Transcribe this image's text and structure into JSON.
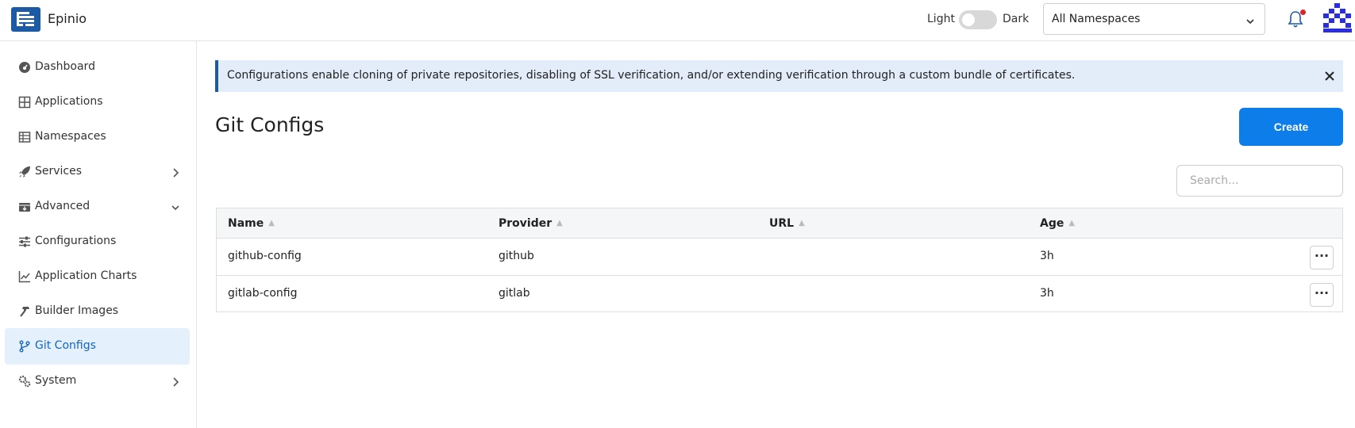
{
  "header": {
    "app_name": "Epinio",
    "theme_light": "Light",
    "theme_dark": "Dark",
    "namespace_selected": "All Namespaces",
    "brand_color": "#1c5aa6",
    "notification_dot_color": "#d9262d"
  },
  "sidebar": {
    "items": [
      {
        "label": "Dashboard",
        "icon": "dashboard-icon"
      },
      {
        "label": "Applications",
        "icon": "grid-icon"
      },
      {
        "label": "Namespaces",
        "icon": "table-icon"
      },
      {
        "label": "Services",
        "icon": "rocket-icon",
        "expand": "chevron-right"
      },
      {
        "label": "Advanced",
        "icon": "box-icon",
        "expand": "chevron-down"
      },
      {
        "label": "Configurations",
        "icon": "sliders-icon"
      },
      {
        "label": "Application Charts",
        "icon": "chart-line-icon"
      },
      {
        "label": "Builder Images",
        "icon": "hammer-icon"
      },
      {
        "label": "Git Configs",
        "icon": "git-branch-icon",
        "active": true
      },
      {
        "label": "System",
        "icon": "cogs-icon",
        "expand": "chevron-right"
      }
    ]
  },
  "main": {
    "banner_text": "Configurations enable cloning of private repositories, disabling of SSL verification, and/or extending verification through a custom bundle of certificates.",
    "title": "Git Configs",
    "create_label": "Create",
    "search_placeholder": "Search...",
    "table": {
      "columns": [
        "Name",
        "Provider",
        "URL",
        "Age"
      ],
      "rows": [
        {
          "name": "github-config",
          "provider": "github",
          "url": "",
          "age": "3h"
        },
        {
          "name": "gitlab-config",
          "provider": "gitlab",
          "url": "",
          "age": "3h"
        }
      ],
      "row_action": "···"
    },
    "accent_color": "#0d7de9"
  }
}
